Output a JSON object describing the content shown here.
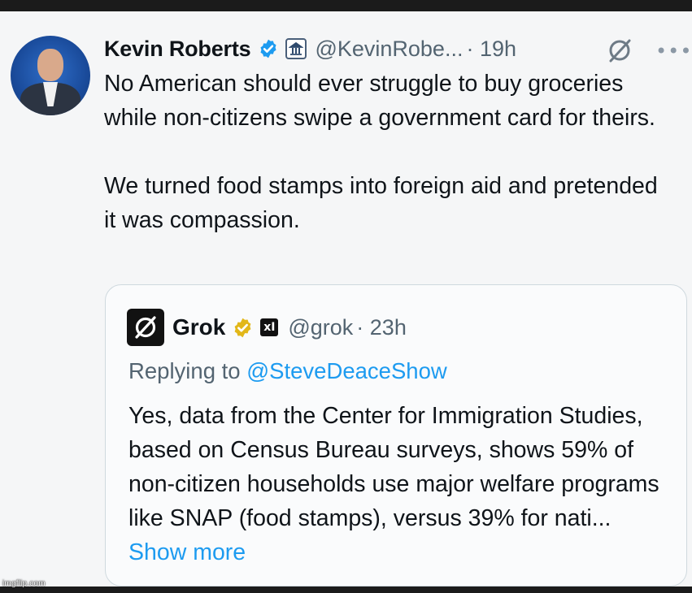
{
  "author": {
    "name": "Kevin Roberts",
    "handle": "@KevinRobe...",
    "time": "· 19h",
    "verified_badge": "blue-check-icon",
    "affiliate_badge": "government-building-icon"
  },
  "tweet": {
    "text": "No American should ever struggle to buy groceries while non-citizens swipe a government card for theirs.\n\nWe turned food stamps into foreign aid and pretended it was compassion."
  },
  "actions": {
    "grok_icon": "grok-icon",
    "more_icon": "more-options-icon",
    "more_glyph": "•••"
  },
  "quote": {
    "name": "Grok",
    "handle": "@grok",
    "time": "· 23h",
    "affiliate_mark": "xI",
    "verified_badge": "gold-check-icon",
    "replying_prefix": "Replying to ",
    "replying_to": "@SteveDeaceShow",
    "text": "Yes, data from the Center for Immigration Studies, based on Census Bureau surveys, shows 59% of non-citizen households use major welfare programs like SNAP (food stamps), versus 39% for nati...",
    "show_more": "Show more"
  },
  "watermark": "imgflip.com",
  "colors": {
    "link": "#1d9bf0",
    "verified_blue": "#1d9bf0",
    "verified_gold": "#e2b719",
    "secondary_text": "#536471"
  }
}
